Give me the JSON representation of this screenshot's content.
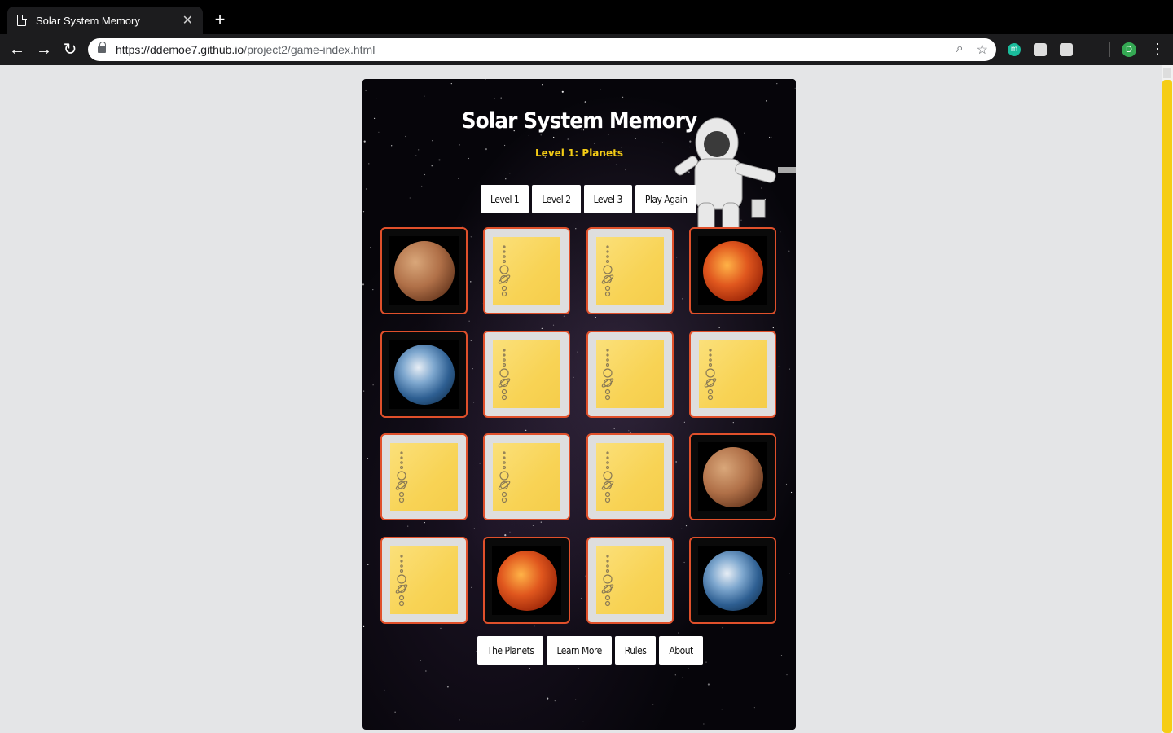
{
  "browser": {
    "tab_title": "Solar System Memory",
    "url_host": "https://ddemoe7.github.io",
    "url_path": "/project2/game-index.html",
    "profile_initial": "D",
    "ext_m_letter": "m"
  },
  "game": {
    "title": "Solar System Memory",
    "subtitle": "Level 1: Planets",
    "top_buttons": [
      "Level 1",
      "Level 2",
      "Level 3",
      "Play Again"
    ],
    "bottom_buttons": [
      "The Planets",
      "Learn More",
      "Rules",
      "About"
    ],
    "cards": [
      [
        "mars",
        "back",
        "back",
        "venus"
      ],
      [
        "earth",
        "back",
        "back",
        "back"
      ],
      [
        "back",
        "back",
        "back",
        "mars"
      ],
      [
        "back",
        "venus",
        "back",
        "earth"
      ]
    ]
  },
  "colors": {
    "accent": "#f5cd15",
    "card_border": "#e0502b",
    "card_back": "#f8d355"
  }
}
